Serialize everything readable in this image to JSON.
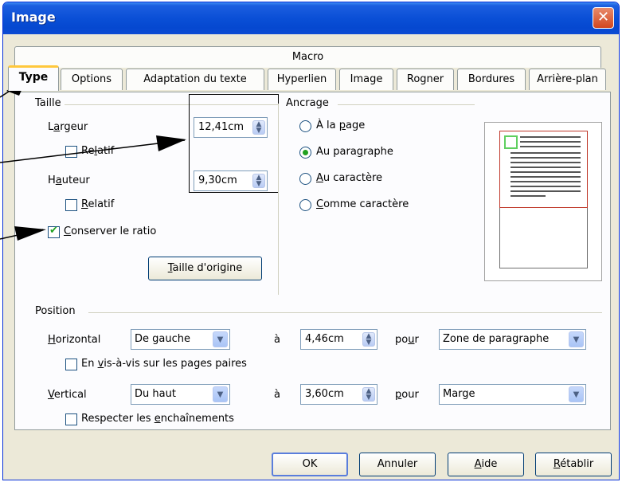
{
  "window": {
    "title": "Image",
    "close_label": "✕"
  },
  "tabs": {
    "macro": "Macro",
    "type": "Type",
    "options": "Options",
    "adaptation": "Adaptation du texte",
    "hyperlien": "Hyperlien",
    "image": "Image",
    "rogner": "Rogner",
    "bordures": "Bordures",
    "arriere_plan": "Arrière-plan"
  },
  "taille": {
    "group_label": "Taille",
    "largeur_label_pre": "L",
    "largeur_label_u": "a",
    "largeur_label_post": "rgeur",
    "largeur_value": "12,41cm",
    "relatif1_pre": "Re",
    "relatif1_u": "l",
    "relatif1_post": "atif",
    "hauteur_label_pre": "H",
    "hauteur_label_u": "a",
    "hauteur_label_post": "uteur",
    "hauteur_value": "9,30cm",
    "relatif2_u": "R",
    "relatif2_post": "elatif",
    "conserver_u": "C",
    "conserver_post": "onserver le ratio",
    "taille_origine_u": "T",
    "taille_origine_post": "aille d'origine"
  },
  "ancrage": {
    "group_label": "Ancrage",
    "a_la_page_pre": "À la ",
    "a_la_page_u": "p",
    "a_la_page_post": "age",
    "au_paragraphe_pre": "Au para",
    "au_paragraphe_u": "g",
    "au_paragraphe_post": "raphe",
    "au_caractere_u": "A",
    "au_caractere_post": "u caractère",
    "comme_caractere_u": "C",
    "comme_caractere_post": "omme caractère",
    "selected": "au_paragraphe"
  },
  "position": {
    "group_label": "Position",
    "horizontal_u": "H",
    "horizontal_post": "orizontal",
    "horizontal_value": "De gauche",
    "a1": "à",
    "h_value": "4,46cm",
    "pour1_pre": "po",
    "pour1_u": "u",
    "pour1_post": "r",
    "h_ref": "Zone de paragraphe",
    "vis_a_vis_pre": "En ",
    "vis_a_vis_u": "v",
    "vis_a_vis_post": "is-à-vis sur les pages paires",
    "vertical_u": "V",
    "vertical_post": "ertical",
    "vertical_value": "Du haut",
    "a2": "à",
    "v_value": "3,60cm",
    "pour2_u": "p",
    "pour2_post": "our",
    "v_ref": "Marge",
    "respecter_pre": "Respecter les ",
    "respecter_u": "e",
    "respecter_post": "nchaînements"
  },
  "buttons": {
    "ok": "OK",
    "annuler": "Annuler",
    "aide_u": "A",
    "aide_post": "ide",
    "retablir_u": "R",
    "retablir_post": "établir"
  },
  "colors": {
    "titlebar": "#0a4fd6",
    "active_tab_accent": "#ffc83c",
    "check_green": "#21a121",
    "preview_frame_red": "#c0392b",
    "preview_anchor_green": "#5fcf5f"
  }
}
